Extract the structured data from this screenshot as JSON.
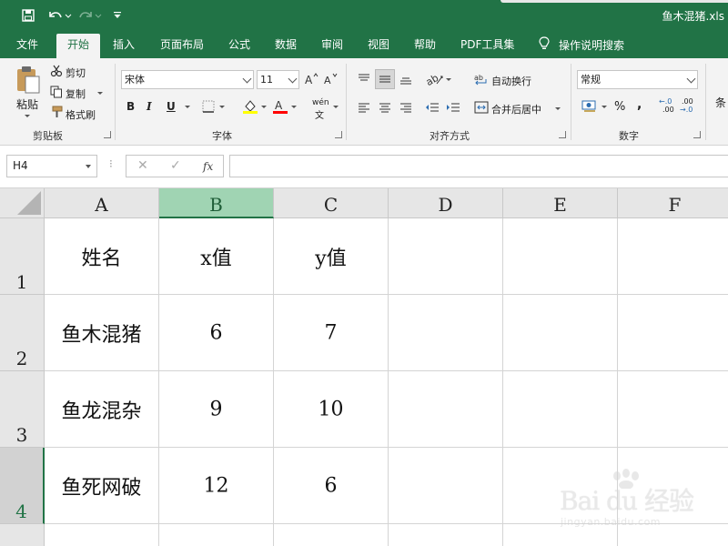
{
  "window": {
    "title": "鱼木混猪.xls"
  },
  "tabs": [
    {
      "label": "文件"
    },
    {
      "label": "开始"
    },
    {
      "label": "插入"
    },
    {
      "label": "页面布局"
    },
    {
      "label": "公式"
    },
    {
      "label": "数据"
    },
    {
      "label": "审阅"
    },
    {
      "label": "视图"
    },
    {
      "label": "帮助"
    },
    {
      "label": "PDF工具集"
    }
  ],
  "tell_me": "操作说明搜索",
  "ribbon": {
    "clipboard": {
      "paste": "粘贴",
      "cut": "剪切",
      "copy": "复制",
      "format_painter": "格式刷",
      "label": "剪贴板"
    },
    "font": {
      "name": "宋体",
      "size": "11",
      "bold": "B",
      "italic": "I",
      "underline": "U",
      "phonetic": "wén",
      "label": "字体"
    },
    "alignment": {
      "wrap_text": "自动换行",
      "merge_center": "合并后居中",
      "label": "对齐方式"
    },
    "number": {
      "format": "常规",
      "percent": "%",
      "comma": ",",
      "inc_decimal_a": "←.0",
      "inc_decimal_b": ".00",
      "dec_decimal_a": ".00",
      "dec_decimal_b": "→.0",
      "label": "数字"
    },
    "styles_cut": "条"
  },
  "formula_bar": {
    "name_box": "H4",
    "cancel": "✕",
    "enter": "✓",
    "fx": "fx",
    "value": ""
  },
  "sheet": {
    "columns": [
      "A",
      "B",
      "C",
      "D",
      "E",
      "F"
    ],
    "rows": [
      "1",
      "2",
      "3",
      "4"
    ],
    "selected_column": "B",
    "selected_row": "4",
    "cells": [
      [
        "姓名",
        "x值",
        "y值",
        "",
        "",
        ""
      ],
      [
        "鱼木混猪",
        "6",
        "7",
        "",
        "",
        ""
      ],
      [
        "鱼龙混杂",
        "9",
        "10",
        "",
        "",
        ""
      ],
      [
        "鱼死网破",
        "12",
        "6",
        "",
        "",
        ""
      ]
    ]
  },
  "watermark": {
    "text": "Bai du 经验",
    "sub": "jingyan.baidu.com"
  }
}
